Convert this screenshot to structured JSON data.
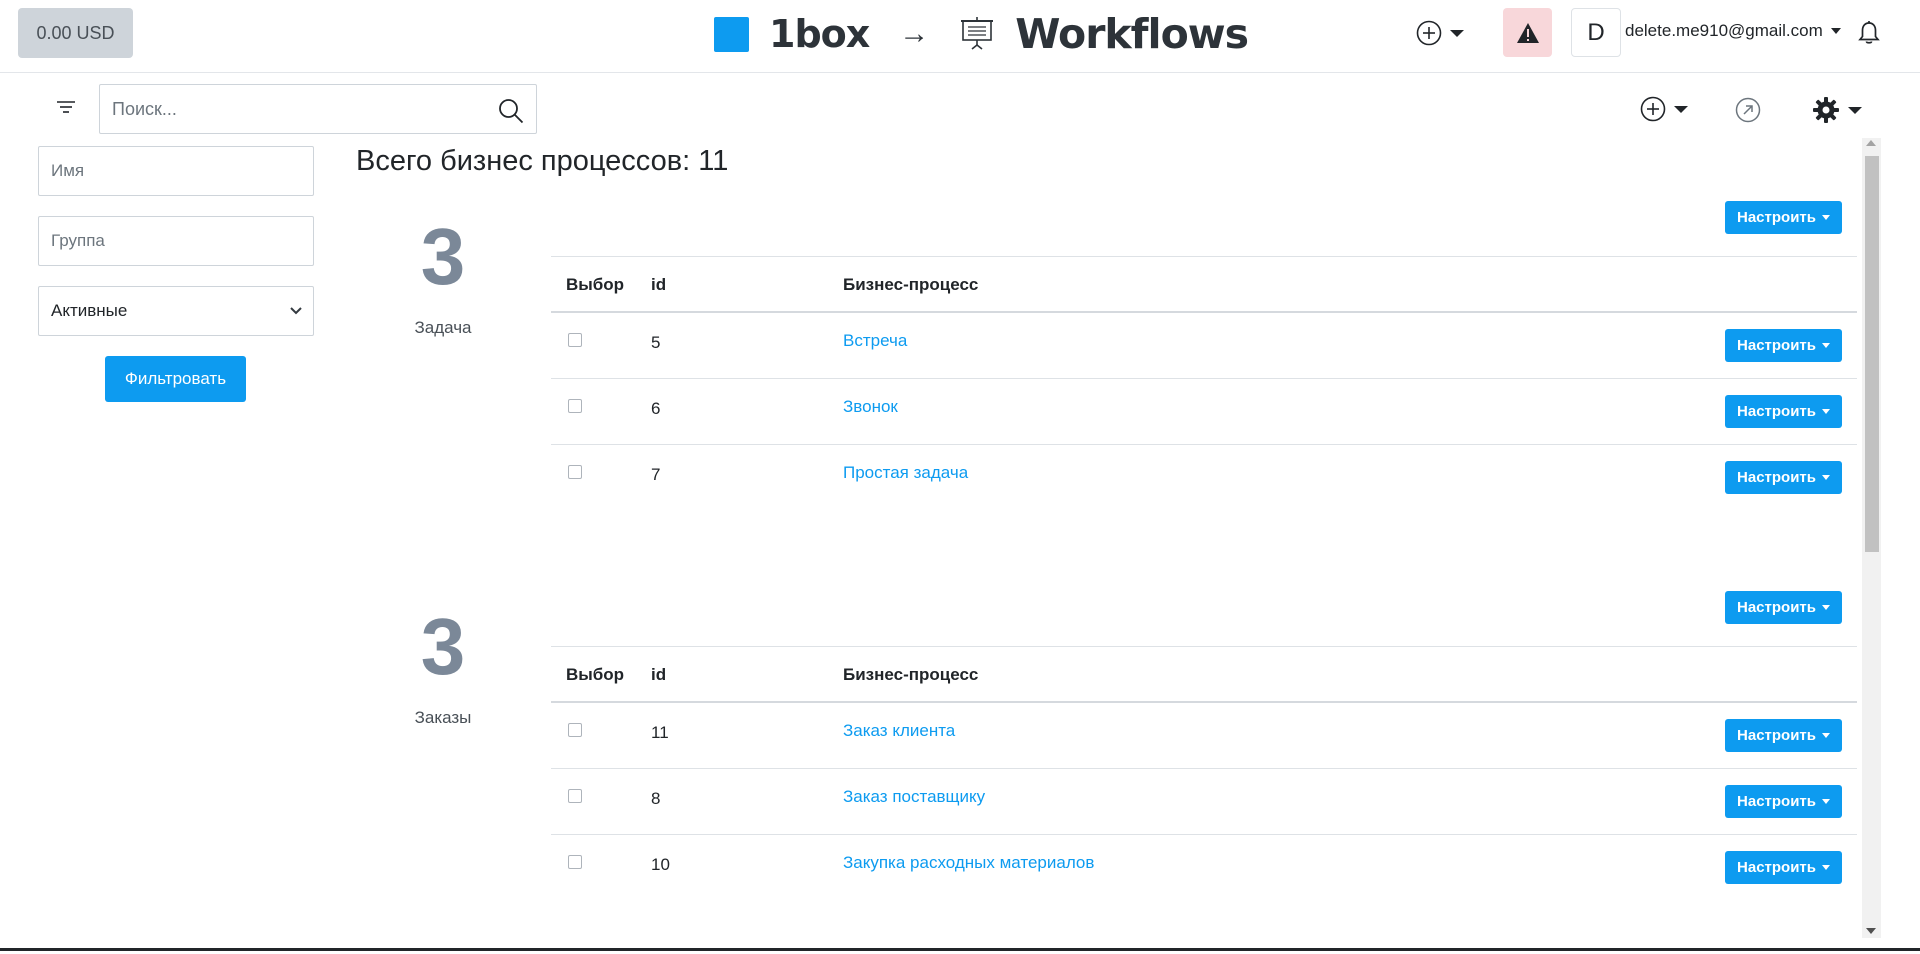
{
  "header": {
    "balance": "0.00 USD",
    "brand_name": "1box",
    "brand_arrow": "→",
    "app_name": "Workflows",
    "avatar_letter": "D",
    "user_email": "delete.me910@gmail.com",
    "brand_color": "#0d9bf0"
  },
  "toolbar": {
    "search_placeholder": "Поиск..."
  },
  "filters": {
    "name_placeholder": "Имя",
    "group_placeholder": "Группа",
    "status_value": "Активные",
    "filter_button": "Фильтровать"
  },
  "main": {
    "total_label": "Всего бизнес процессов: 11",
    "columns": {
      "select": "Выбор",
      "id": "id",
      "name": "Бизнес-процесс"
    },
    "configure_label": "Настроить",
    "groups": [
      {
        "count": "3",
        "name": "Задача",
        "rows": [
          {
            "id": "5",
            "name": "Встреча"
          },
          {
            "id": "6",
            "name": "Звонок"
          },
          {
            "id": "7",
            "name": "Простая задача"
          }
        ]
      },
      {
        "count": "3",
        "name": "Заказы",
        "rows": [
          {
            "id": "11",
            "name": "Заказ клиента"
          },
          {
            "id": "8",
            "name": "Заказ поставщику"
          },
          {
            "id": "10",
            "name": "Закупка расходных материалов"
          }
        ]
      }
    ]
  }
}
